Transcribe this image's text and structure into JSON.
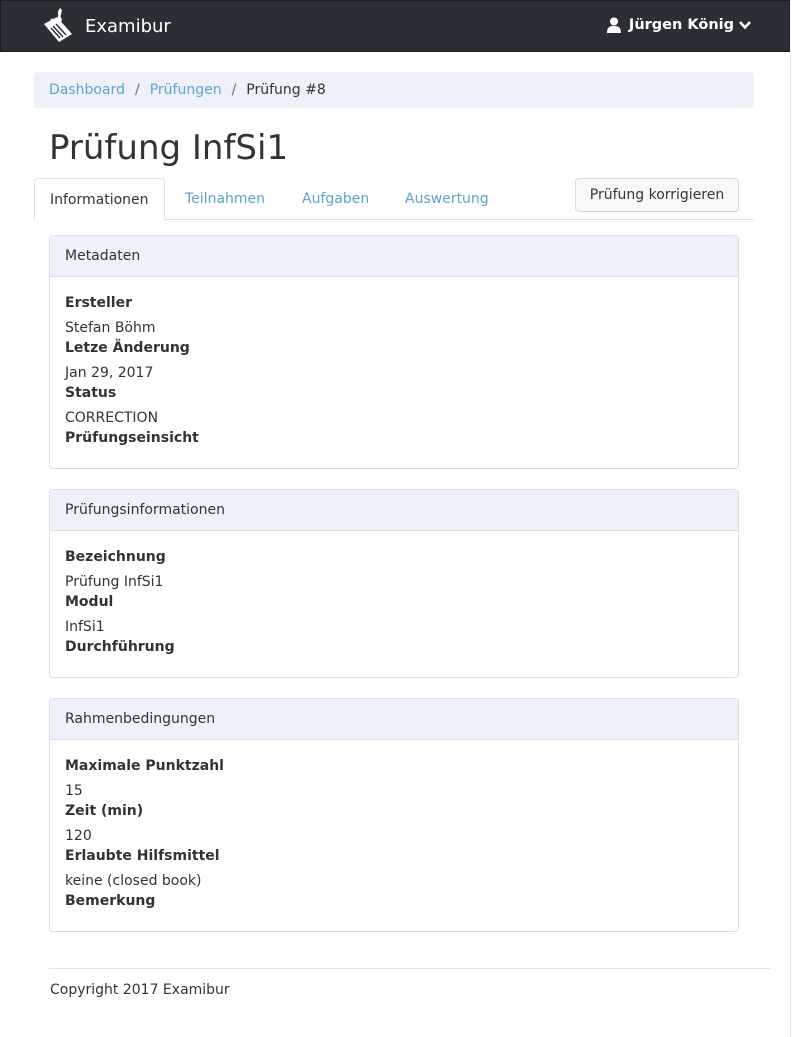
{
  "app": {
    "name": "Examibur",
    "logo": "scroll-pen-logo"
  },
  "user": {
    "name": "Jürgen König",
    "icon": "user-icon",
    "caret": "chevron-down-icon"
  },
  "breadcrumb": {
    "items": [
      "Dashboard",
      "Prüfungen"
    ],
    "current": "Prüfung #8",
    "separator": "/"
  },
  "page": {
    "title": "Prüfung InfSi1"
  },
  "tabs": [
    "Informationen",
    "Teilnahmen",
    "Aufgaben",
    "Auswertung"
  ],
  "actions": {
    "correct": "Prüfung korrigieren"
  },
  "cards": {
    "metadata": {
      "title": "Metadaten",
      "creator_label": "Ersteller",
      "creator": "Stefan Böhm",
      "modified_label": "Letze Änderung",
      "modified": "Jan 29, 2017",
      "status_label": "Status",
      "status": "CORRECTION",
      "review_label": "Prüfungseinsicht"
    },
    "exam_info": {
      "title": "Prüfungsinformationen",
      "name_label": "Bezeichnung",
      "name": "Prüfung InfSi1",
      "module_label": "Modul",
      "module": "InfSi1",
      "conduct_label": "Durchführung"
    },
    "conditions": {
      "title": "Rahmenbedingungen",
      "max_points_label": "Maximale Punktzahl",
      "max_points": "15",
      "time_label": "Zeit (min)",
      "time": "120",
      "aids_label": "Erlaubte Hilfsmittel",
      "aids": "keine (closed book)",
      "remark_label": "Bemerkung"
    }
  },
  "footer": {
    "copyright": "Copyright 2017 Examibur"
  },
  "colors": {
    "navbar": "#2b2e35",
    "link": "#5aa4cf",
    "panel_header": "#eef1f9",
    "text": "#333333"
  }
}
